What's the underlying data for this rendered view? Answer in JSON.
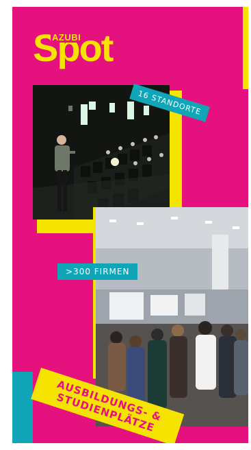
{
  "logo": {
    "azubi": "AZUBI",
    "spot": "Spot"
  },
  "tags": {
    "standorte": "16 STANDORTE",
    "firmen": ">300 FIRMEN"
  },
  "banner": {
    "line1": "AUSBILDUNGS- &",
    "line2": "STUDIENPLÄTZE"
  },
  "colors": {
    "magenta": "#e5117e",
    "yellow": "#f5e400",
    "cyan": "#10a6b8"
  },
  "images": {
    "photo1": "cinema-presentation-photo",
    "photo2": "trade-fair-crowd-photo"
  }
}
